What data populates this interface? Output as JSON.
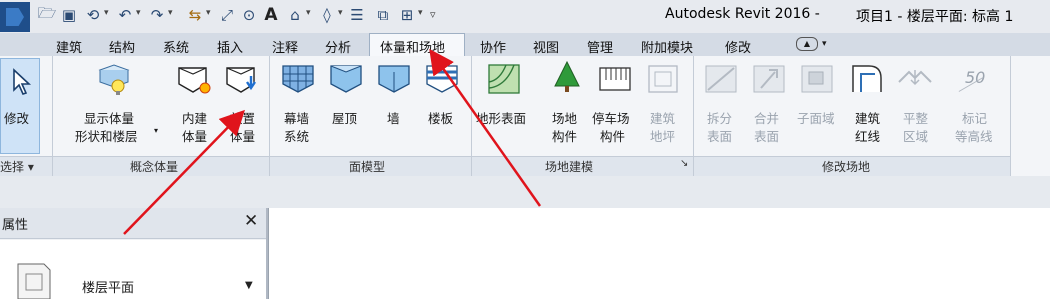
{
  "titlebar": {
    "app_name": "Autodesk Revit 2016 -",
    "project_view": "项目1 - 楼层平面: 标高 1",
    "qat_icons": [
      "open-icon",
      "save-icon",
      "sync-icon",
      "undo-icon",
      "redo-icon",
      "measure-icon",
      "dimension-icon",
      "tag-icon",
      "text-icon",
      "3d-view-icon",
      "section-icon",
      "thin-lines-icon",
      "close-windows-icon",
      "switch-windows-icon",
      "customize-qat-icon"
    ],
    "text_icon_glyph": "A"
  },
  "tabs": [
    "建筑",
    "结构",
    "系统",
    "插入",
    "注释",
    "分析",
    "体量和场地",
    "协作",
    "视图",
    "管理",
    "附加模块",
    "修改"
  ],
  "active_tab": "体量和场地",
  "ribbon": {
    "modify": {
      "label": "修改",
      "panel": "选择 ▾"
    },
    "conceptual_mass": {
      "panel": "概念体量",
      "tools": [
        {
          "label_1": "显示体量",
          "label_2": "形状和楼层"
        },
        {
          "label_1": "内建",
          "label_2": "体量"
        },
        {
          "label_1": "放置",
          "label_2": "体量"
        }
      ]
    },
    "model_by_face": {
      "panel": "面模型",
      "tools": [
        {
          "label_1": "幕墙",
          "label_2": "系统"
        },
        {
          "label_1": "屋顶",
          "label_2": ""
        },
        {
          "label_1": "墙",
          "label_2": ""
        },
        {
          "label_1": "楼板",
          "label_2": ""
        }
      ]
    },
    "site_modeling": {
      "panel": "场地建模",
      "launcher": "↘",
      "tools": [
        {
          "label_1": "地形表面",
          "label_2": ""
        },
        {
          "label_1": "场地",
          "label_2": "构件"
        },
        {
          "label_1": "停车场",
          "label_2": "构件"
        },
        {
          "label_1": "建筑",
          "label_2": "地坪"
        }
      ]
    },
    "modify_site": {
      "panel": "修改场地",
      "tools": [
        {
          "label_1": "拆分",
          "label_2": "表面"
        },
        {
          "label_1": "合并",
          "label_2": "表面"
        },
        {
          "label_1": "子面域",
          "label_2": ""
        },
        {
          "label_1": "建筑",
          "label_2": "红线"
        },
        {
          "label_1": "平整",
          "label_2": "区域"
        },
        {
          "label_1": "标记",
          "label_2": "等高线"
        }
      ],
      "contour_icon_text": "50"
    }
  },
  "properties": {
    "title": "属性",
    "close": "✕",
    "type": "楼层平面",
    "dropdown": "▼"
  },
  "colors": {
    "annotation_arrow": "#e0141c",
    "ribbon_bg": "#f3f5f8"
  }
}
